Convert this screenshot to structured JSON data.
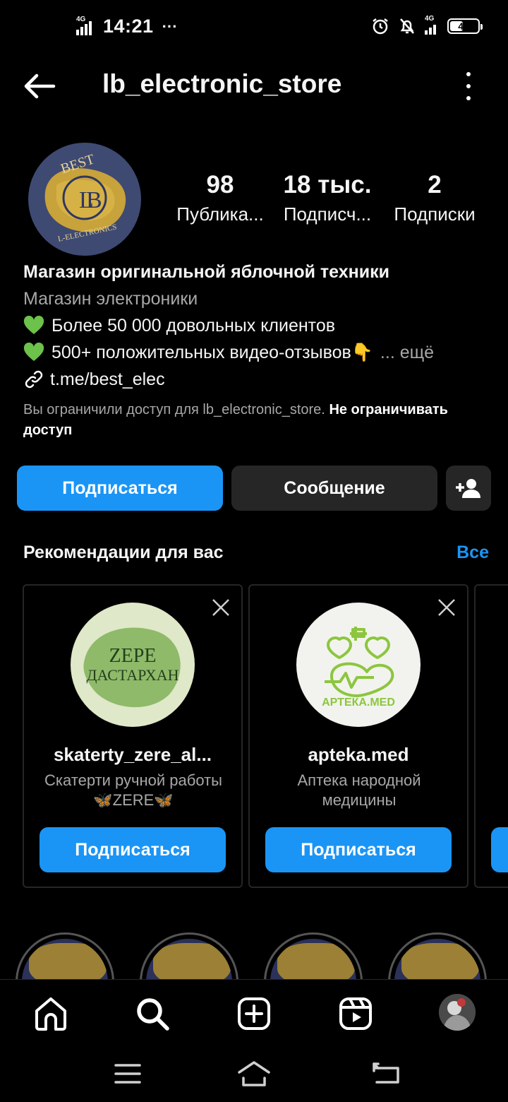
{
  "status": {
    "time": "14:21",
    "dots": "···",
    "net_left": "4G",
    "net_right": "4G",
    "battery": "48",
    "battery_level": 0.48
  },
  "header": {
    "title": "lb_electronic_store"
  },
  "profile": {
    "avatar_text_top": "BEST",
    "avatar_text_bottom": "L-ELECTRONICS",
    "stats": [
      {
        "num": "98",
        "label": "Публика..."
      },
      {
        "num": "18 тыс.",
        "label": "Подписч..."
      },
      {
        "num": "2",
        "label": "Подписки"
      }
    ],
    "name": "Магазин оригинальной яблочной техники",
    "category": "Магазин электроники",
    "bio_lines": [
      "Более 50 000 довольных клиентов",
      "500+ положительных видео-отзывов👇"
    ],
    "more": "... ещё",
    "link": "t.me/best_elec",
    "restrict_text": "Вы ограничили доступ для lb_electronic_store.",
    "restrict_action": "Не ограничивать доступ"
  },
  "actions": {
    "follow": "Подписаться",
    "message": "Сообщение"
  },
  "recommendations": {
    "title": "Рекомендации для вас",
    "see_all": "Все",
    "cards": [
      {
        "username": "skaterty_zere_al...",
        "desc": "Скатерти ручной работы 🦋ZERE🦋",
        "pic_line1": "ZEPE",
        "pic_line2": "ДАСТАРХАН",
        "button": "Подписаться"
      },
      {
        "username": "apteka.med",
        "desc": "Аптека народной медицины",
        "pic_line1": "АРТЕКА.МЕD",
        "button": "Подписаться"
      }
    ]
  },
  "colors": {
    "accent": "#1a95f6",
    "background": "#000000",
    "secondary_button": "#262626",
    "muted_text": "#a8a8a8"
  },
  "icons": {
    "nav": [
      "home-icon",
      "search-icon",
      "create-icon",
      "reels-icon",
      "profile-avatar"
    ],
    "system": [
      "menu-icon",
      "home-icon",
      "back-icon"
    ]
  }
}
